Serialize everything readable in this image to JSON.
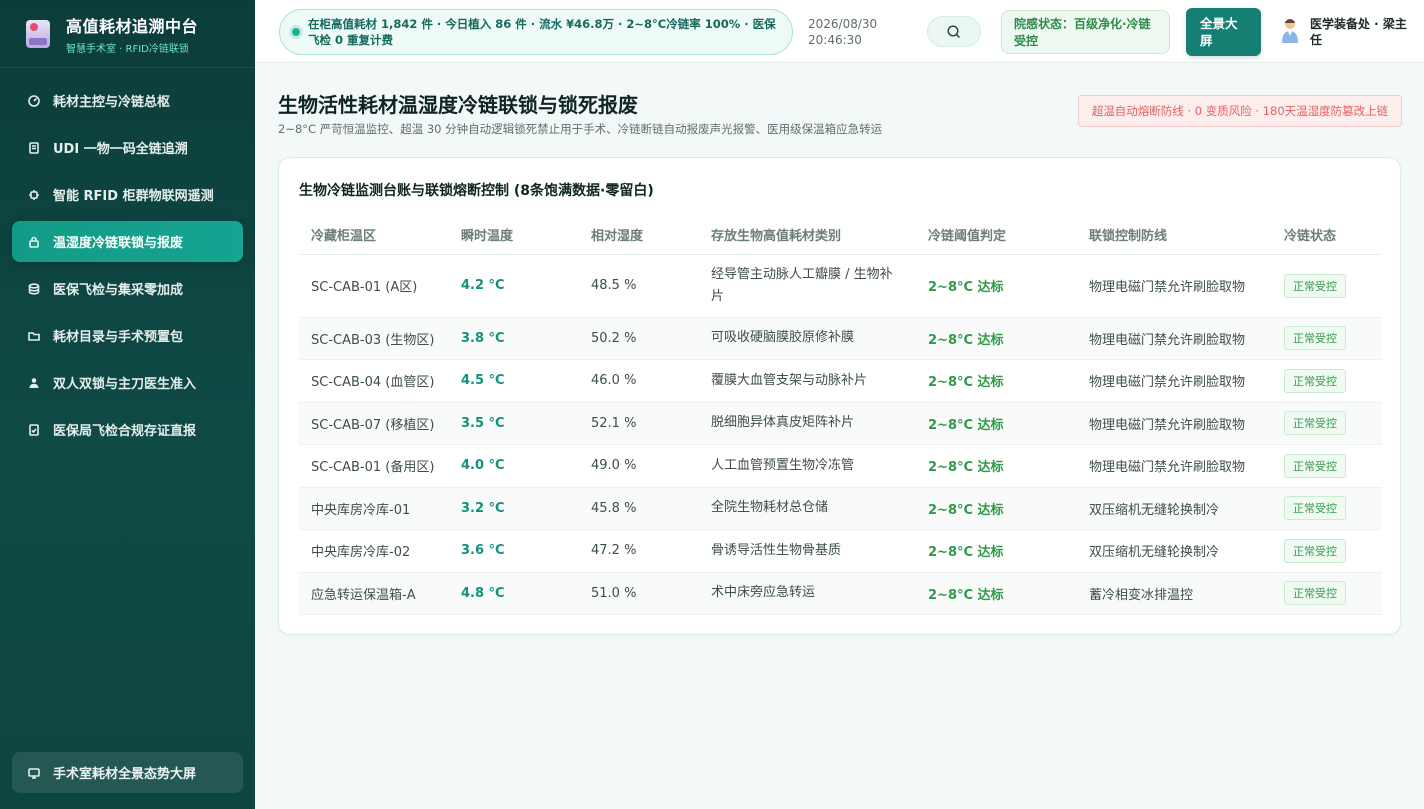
{
  "brand": {
    "title": "高值耗材追溯中台",
    "subtitle": "智慧手术室 · RFID冷链联锁"
  },
  "sidebar": {
    "items": [
      {
        "label": "耗材主控与冷链总枢",
        "icon": "gauge-icon",
        "active": false
      },
      {
        "label": "UDI 一物一码全链追溯",
        "icon": "document-icon",
        "active": false
      },
      {
        "label": "智能 RFID 柜群物联网遥测",
        "icon": "chip-icon",
        "active": false
      },
      {
        "label": "温湿度冷链联锁与报废",
        "icon": "lock-icon",
        "active": true
      },
      {
        "label": "医保飞检与集采零加成",
        "icon": "database-icon",
        "active": false
      },
      {
        "label": "耗材目录与手术预置包",
        "icon": "folder-icon",
        "active": false
      },
      {
        "label": "双人双锁与主刀医生准入",
        "icon": "user-icon",
        "active": false
      },
      {
        "label": "医保局飞检合规存证直报",
        "icon": "file-check-icon",
        "active": false
      }
    ],
    "bottom_button": "手术室耗材全景态势大屏"
  },
  "topbar": {
    "ticker": "在柜高值耗材 1,842 件 · 今日植入 86 件 · 流水 ¥46.8万 · 2~8°C冷链率 100% · 医保飞检 0 重复计费",
    "date": "2026/08/30",
    "time": "20:46:30",
    "status": "院感状态：百级净化·冷链受控",
    "screen_button": "全景大屏",
    "user": "医学装备处 · 梁主任"
  },
  "page": {
    "title": "生物活性耗材温湿度冷链联锁与锁死报废",
    "subtitle": "2~8°C 严苛恒温监控、超温 30 分钟自动逻辑锁死禁止用于手术、冷链断链自动报废声光报警、医用级保温箱应急转运",
    "warning": "超温自动熔断防线 · 0 变质风险 · 180天温湿度防篡改上链"
  },
  "table": {
    "title": "生物冷链监测台账与联锁熔断控制 (8条饱满数据·零留白)",
    "columns": [
      "冷藏柜温区",
      "瞬时温度",
      "相对湿度",
      "存放生物高值耗材类别",
      "冷链阈值判定",
      "联锁控制防线",
      "冷链状态"
    ],
    "rows": [
      {
        "zone": "SC-CAB-01 (A区)",
        "temp": "4.2 °C",
        "humidity": "48.5 %",
        "category": "经导管主动脉人工瓣膜 / 生物补片",
        "judge": "2~8°C 达标",
        "defense": "物理电磁门禁允许刷脸取物",
        "status": "正常受控"
      },
      {
        "zone": "SC-CAB-03 (生物区)",
        "temp": "3.8 °C",
        "humidity": "50.2 %",
        "category": "可吸收硬脑膜胶原修补膜",
        "judge": "2~8°C 达标",
        "defense": "物理电磁门禁允许刷脸取物",
        "status": "正常受控"
      },
      {
        "zone": "SC-CAB-04 (血管区)",
        "temp": "4.5 °C",
        "humidity": "46.0 %",
        "category": "覆膜大血管支架与动脉补片",
        "judge": "2~8°C 达标",
        "defense": "物理电磁门禁允许刷脸取物",
        "status": "正常受控"
      },
      {
        "zone": "SC-CAB-07 (移植区)",
        "temp": "3.5 °C",
        "humidity": "52.1 %",
        "category": "脱细胞异体真皮矩阵补片",
        "judge": "2~8°C 达标",
        "defense": "物理电磁门禁允许刷脸取物",
        "status": "正常受控"
      },
      {
        "zone": "SC-CAB-01 (备用区)",
        "temp": "4.0 °C",
        "humidity": "49.0 %",
        "category": "人工血管预置生物冷冻管",
        "judge": "2~8°C 达标",
        "defense": "物理电磁门禁允许刷脸取物",
        "status": "正常受控"
      },
      {
        "zone": "中央库房冷库-01",
        "temp": "3.2 °C",
        "humidity": "45.8 %",
        "category": "全院生物耗材总仓储",
        "judge": "2~8°C 达标",
        "defense": "双压缩机无缝轮换制冷",
        "status": "正常受控"
      },
      {
        "zone": "中央库房冷库-02",
        "temp": "3.6 °C",
        "humidity": "47.2 %",
        "category": "骨诱导活性生物骨基质",
        "judge": "2~8°C 达标",
        "defense": "双压缩机无缝轮换制冷",
        "status": "正常受控"
      },
      {
        "zone": "应急转运保温箱-A",
        "temp": "4.8 °C",
        "humidity": "51.0 %",
        "category": "术中床旁应急转运",
        "judge": "2~8°C 达标",
        "defense": "蓄冷相变冰排温控",
        "status": "正常受控"
      }
    ]
  },
  "colors": {
    "sidebar_bg": "#0c3d3a",
    "accent": "#129c88",
    "ok_green": "#2e9a4a",
    "warn_red": "#e26262"
  }
}
